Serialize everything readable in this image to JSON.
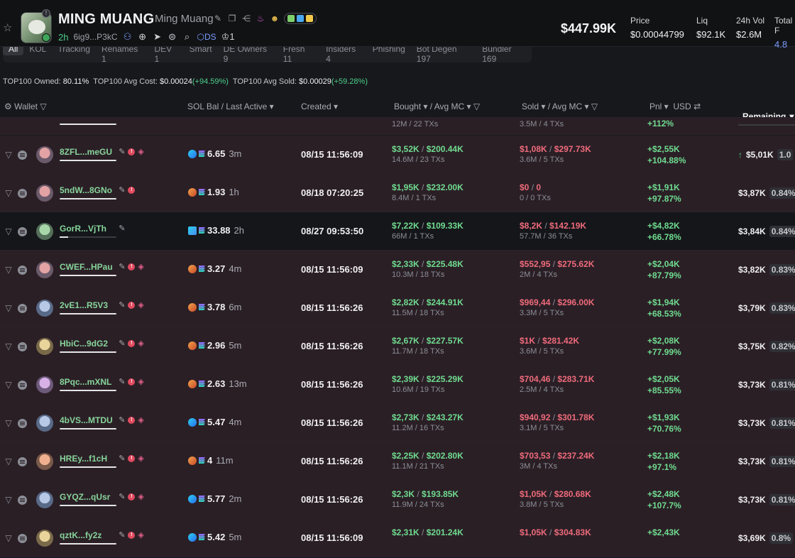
{
  "token": {
    "name": "MING MUANG",
    "subname": "Ming Muang",
    "age": "2h",
    "address": "6ig9...P3kC",
    "ds_label": "DS",
    "holders": "1",
    "market_cap": "$447.99K"
  },
  "stats": [
    {
      "label": "Price",
      "value": "$0.00044799"
    },
    {
      "label": "Liq",
      "value": "$92.1K"
    },
    {
      "label": "24h Vol",
      "value": "$2.6M"
    },
    {
      "label": "Total F",
      "value": "4.8"
    }
  ],
  "tabs": [
    "All",
    "KOL",
    "Tracking",
    "Renames 1",
    "DEV 1",
    "Smart",
    "DE Owners 9",
    "Fresh 11",
    "Insiders 4",
    "Phishing",
    "Bot Degen 197",
    "Bundler 169"
  ],
  "summary": {
    "owned_label": "TOP100 Owned:",
    "owned_value": "80.11%",
    "avg_cost_label": "TOP100 Avg Cost:",
    "avg_cost_value": "$0.00024",
    "avg_cost_change": "(+94.59%)",
    "avg_sold_label": "TOP100 Avg Sold:",
    "avg_sold_value": "$0.00029",
    "avg_sold_change": "(+59.28%)"
  },
  "columns": {
    "wallet": "Wallet",
    "sol_bal": "SOL Bal",
    "last_active": "/ Last Active",
    "created": "Created",
    "bought": "Bought",
    "avg_mc": "/ Avg MC",
    "sold": "Sold",
    "sold_avg_mc": "/ Avg MC",
    "pnl": "Pnl",
    "usd": "USD",
    "remaining": "Remaining"
  },
  "partial_row": {
    "bought_sub": "12M / 22 TXs",
    "sold_sub": "3.5M / 4 TXs",
    "pnl": "+112%"
  },
  "rows": [
    {
      "name": "8ZFL...meGU",
      "sol": "6.65",
      "active": "3m",
      "created": "08/15 11:56:09",
      "b1": "$3,52K",
      "b2": "$200.44K",
      "bsub": "14.6M / 23 TXs",
      "s1": "$1,08K",
      "s2": "$297.73K",
      "ssub": "3.6M / 5 TXs",
      "p1": "+$2,55K",
      "p2": "+104.88%",
      "rem": "$5,01K",
      "pct": "1.0"
    },
    {
      "name": "5ndW...8GNo",
      "sol": "1.93",
      "active": "1h",
      "created": "08/18 07:20:25",
      "b1": "$1,95K",
      "b2": "$232.00K",
      "bsub": "8.4M / 1 TXs",
      "s1": "$0",
      "s2": "0",
      "ssub": "0 / 0 TXs",
      "p1": "+$1,91K",
      "p2": "+97.87%",
      "rem": "$3,87K",
      "pct": "0.84%"
    },
    {
      "name": "GorR...VjTh",
      "sol": "33.88",
      "active": "2h",
      "created": "08/27 09:53:50",
      "b1": "$7,22K",
      "b2": "$109.33K",
      "bsub": "66M / 1 TXs",
      "s1": "$8,2K",
      "s2": "$142.19K",
      "ssub": "57.7M / 36 TXs",
      "p1": "+$4,82K",
      "p2": "+66.78%",
      "rem": "$3,84K",
      "pct": "0.84%"
    },
    {
      "name": "CWEF...HPau",
      "sol": "3.27",
      "active": "4m",
      "created": "08/15 11:56:09",
      "b1": "$2,33K",
      "b2": "$225.48K",
      "bsub": "10.3M / 18 TXs",
      "s1": "$552,95",
      "s2": "$275.62K",
      "ssub": "2M / 4 TXs",
      "p1": "+$2,04K",
      "p2": "+87.79%",
      "rem": "$3,82K",
      "pct": "0.83%"
    },
    {
      "name": "2vE1...R5V3",
      "sol": "3.78",
      "active": "6m",
      "created": "08/15 11:56:26",
      "b1": "$2,82K",
      "b2": "$244.91K",
      "bsub": "11.5M / 18 TXs",
      "s1": "$969,44",
      "s2": "$296.00K",
      "ssub": "3.3M / 5 TXs",
      "p1": "+$1,94K",
      "p2": "+68.53%",
      "rem": "$3,79K",
      "pct": "0.83%"
    },
    {
      "name": "HbiC...9dG2",
      "sol": "2.96",
      "active": "5m",
      "created": "08/15 11:56:26",
      "b1": "$2,67K",
      "b2": "$227.57K",
      "bsub": "11.7M / 18 TXs",
      "s1": "$1K",
      "s2": "$281.42K",
      "ssub": "3.6M / 5 TXs",
      "p1": "+$2,08K",
      "p2": "+77.99%",
      "rem": "$3,75K",
      "pct": "0.82%"
    },
    {
      "name": "8Pqc...mXNL",
      "sol": "2.63",
      "active": "13m",
      "created": "08/15 11:56:26",
      "b1": "$2,39K",
      "b2": "$225.29K",
      "bsub": "10.6M / 19 TXs",
      "s1": "$704,46",
      "s2": "$283.71K",
      "ssub": "2.5M / 4 TXs",
      "p1": "+$2,05K",
      "p2": "+85.55%",
      "rem": "$3,73K",
      "pct": "0.81%"
    },
    {
      "name": "4bVS...MTDU",
      "sol": "5.47",
      "active": "4m",
      "created": "08/15 11:56:26",
      "b1": "$2,73K",
      "b2": "$243.27K",
      "bsub": "11.2M / 16 TXs",
      "s1": "$940,92",
      "s2": "$301.78K",
      "ssub": "3.1M / 5 TXs",
      "p1": "+$1,93K",
      "p2": "+70.76%",
      "rem": "$3,73K",
      "pct": "0.81%"
    },
    {
      "name": "HREy...f1cH",
      "sol": "4",
      "active": "11m",
      "created": "08/15 11:56:26",
      "b1": "$2,25K",
      "b2": "$202.80K",
      "bsub": "11.1M / 21 TXs",
      "s1": "$703,53",
      "s2": "$237.24K",
      "ssub": "3M / 4 TXs",
      "p1": "+$2,18K",
      "p2": "+97.1%",
      "rem": "$3,73K",
      "pct": "0.81%"
    },
    {
      "name": "GYQZ...qUsr",
      "sol": "5.77",
      "active": "2m",
      "created": "08/15 11:56:26",
      "b1": "$2,3K",
      "b2": "$193.85K",
      "bsub": "11.9M / 24 TXs",
      "s1": "$1,05K",
      "s2": "$280.68K",
      "ssub": "3.8M / 5 TXs",
      "p1": "+$2,48K",
      "p2": "+107.7%",
      "rem": "$3,73K",
      "pct": "0.81%"
    },
    {
      "name": "qztK...fy2z",
      "sol": "5.42",
      "active": "5m",
      "created": "08/15 11:56:09",
      "b1": "$2,31K",
      "b2": "$201.24K",
      "bsub": "",
      "s1": "$1,05K",
      "s2": "$304.83K",
      "ssub": "",
      "p1": "+$2,43K",
      "p2": "",
      "rem": "$3,69K",
      "pct": "0.8%"
    }
  ]
}
